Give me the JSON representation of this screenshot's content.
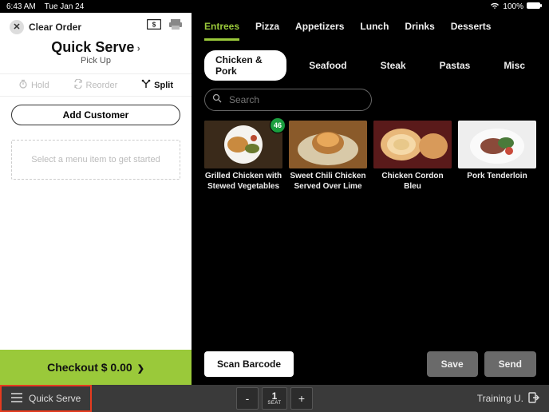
{
  "status": {
    "time": "6:43 AM",
    "date": "Tue Jan 24",
    "battery": "100%"
  },
  "left": {
    "clear": "Clear Order",
    "title": "Quick Serve",
    "subtitle": "Pick Up",
    "hold": "Hold",
    "reorder": "Reorder",
    "split": "Split",
    "add_customer": "Add Customer",
    "placeholder": "Select a menu item to get started",
    "checkout": "Checkout $ 0.00"
  },
  "tabs": [
    "Entrees",
    "Pizza",
    "Appetizers",
    "Lunch",
    "Drinks",
    "Desserts"
  ],
  "subtabs": [
    "Chicken & Pork",
    "Seafood",
    "Steak",
    "Pastas",
    "Misc"
  ],
  "search_placeholder": "Search",
  "products": [
    {
      "label": "Grilled Chicken with Stewed Vegetables",
      "badge": "46"
    },
    {
      "label": "Sweet Chili Chicken Served Over Lime"
    },
    {
      "label": "Chicken Cordon Bleu"
    },
    {
      "label": "Pork Tenderloin"
    }
  ],
  "footer": {
    "scan": "Scan Barcode",
    "save": "Save",
    "send": "Send"
  },
  "bottom": {
    "mode": "Quick Serve",
    "seat_num": "1",
    "seat_label": "SEAT",
    "user": "Training U."
  }
}
